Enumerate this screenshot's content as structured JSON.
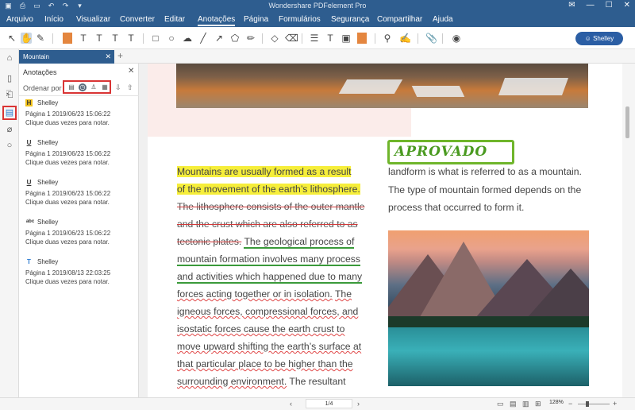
{
  "app": {
    "title": "Wondershare PDFelement Pro"
  },
  "menu": [
    "Arquivo",
    "Início",
    "Visualizar",
    "Converter",
    "Editar",
    "Anotações",
    "Página",
    "Formulários",
    "Segurança",
    "Compartilhar",
    "Ajuda"
  ],
  "menu_active": "Anotações",
  "user": {
    "name": "Shelley"
  },
  "tab": {
    "label": "Mountain"
  },
  "panel": {
    "title": "Anotações",
    "sort_label": "Ordenar por",
    "items": [
      {
        "icon": "H",
        "icon_color": "#f1c21b",
        "author": "Shelley",
        "date": "Página 1    2019/06/23 15:06:22",
        "note": "Clique duas vezes para notar."
      },
      {
        "icon": "U",
        "icon_color": "#333333",
        "author": "Shelley",
        "date": "Página 1    2019/06/23 15:06:22",
        "note": "Clique duas vezes para notar."
      },
      {
        "icon": "U",
        "icon_color": "#333333",
        "author": "Shelley",
        "date": "Página 1    2019/06/23 15:06:22",
        "note": "Clique duas vezes para notar."
      },
      {
        "icon": "abc",
        "icon_color": "#333333",
        "author": "Shelley",
        "date": "Página 1    2019/06/23 15:06:22",
        "note": "Clique duas vezes para notar."
      },
      {
        "icon": "T",
        "icon_color": "#2b7bd1",
        "author": "Shelley",
        "date": "Página 1    2019/08/13 22:03:25",
        "note": "Clique duas vezes para notar."
      }
    ]
  },
  "document": {
    "stamp": "APROVADO",
    "left_lines": {
      "hl1": "Mountains are usually formed as a result",
      "hl2": "of the movement of the earth’s lithosphere.",
      "st1": "The lithosphere consists of the outer mantle",
      "st2": "and the crust which are also referred to as",
      "st3": "tectonic plates.",
      "ul1": "The geological process of",
      "ul2": "mountain formation involves many process",
      "ul3": "and activities which happened due to many",
      "sq1a": "forces acting together or in isolation.",
      "sq1b": "The",
      "sq2": "igneous forces, compressional forces, and",
      "sq3": "isostatic forces cause the earth crust to",
      "sq4": "move upward shifting the earth’s surface at",
      "sq5": "that particular place to be higher than the",
      "sq6a": "surrounding environment.",
      "sq6b": "The resultant"
    },
    "right_lines": [
      "landform is what is referred to as a mountain.",
      "The type of mountain formed depends on the",
      "process that occurred to form it."
    ]
  },
  "status": {
    "page": "1",
    "page_total": "/4",
    "zoom": "128%"
  }
}
